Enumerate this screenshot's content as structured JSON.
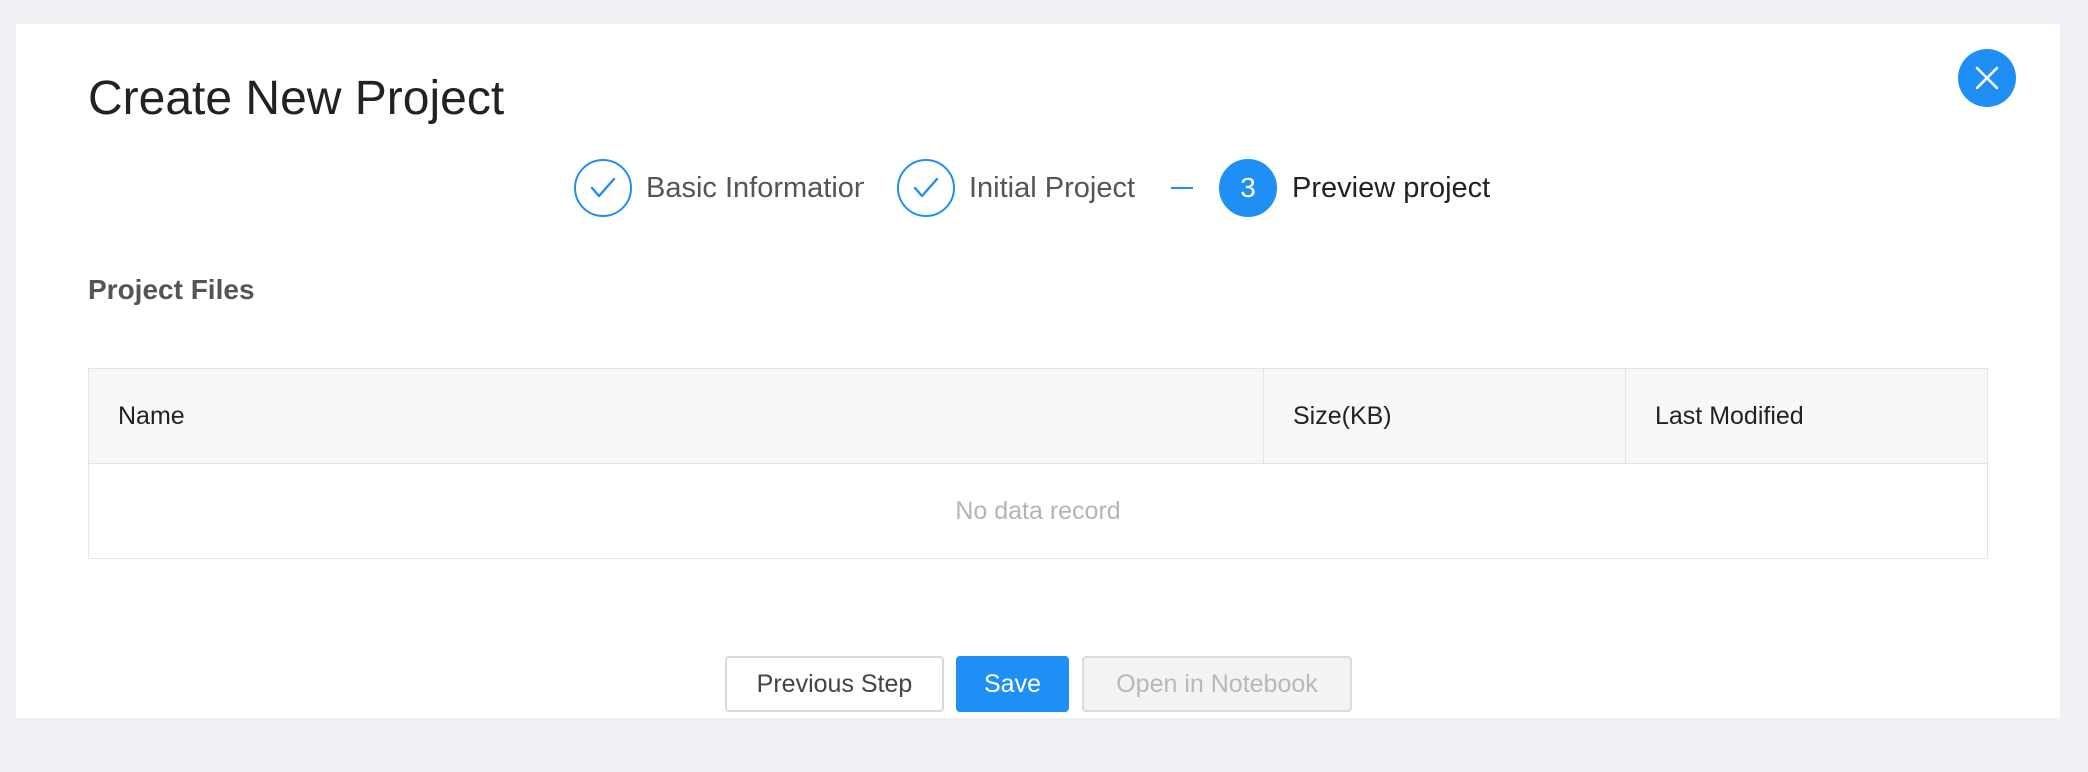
{
  "dialog": {
    "title": "Create New Project",
    "close_icon": "close-icon"
  },
  "steps": [
    {
      "label": "Basic Information",
      "status": "done",
      "icon": "check-icon"
    },
    {
      "label": "Initial Project",
      "status": "done",
      "icon": "check-icon"
    },
    {
      "number": "3",
      "label": "Preview project",
      "status": "active"
    }
  ],
  "files": {
    "section_title": "Project Files",
    "columns": [
      "Name",
      "Size(KB)",
      "Last Modified"
    ],
    "empty_text": "No data record"
  },
  "footer": {
    "previous_label": "Previous Step",
    "save_label": "Save",
    "notebook_label": "Open in Notebook"
  },
  "colors": {
    "accent": "#1f8ff5",
    "page_background": "#f0f1f4",
    "disabled_text": "#b8b8bc"
  }
}
